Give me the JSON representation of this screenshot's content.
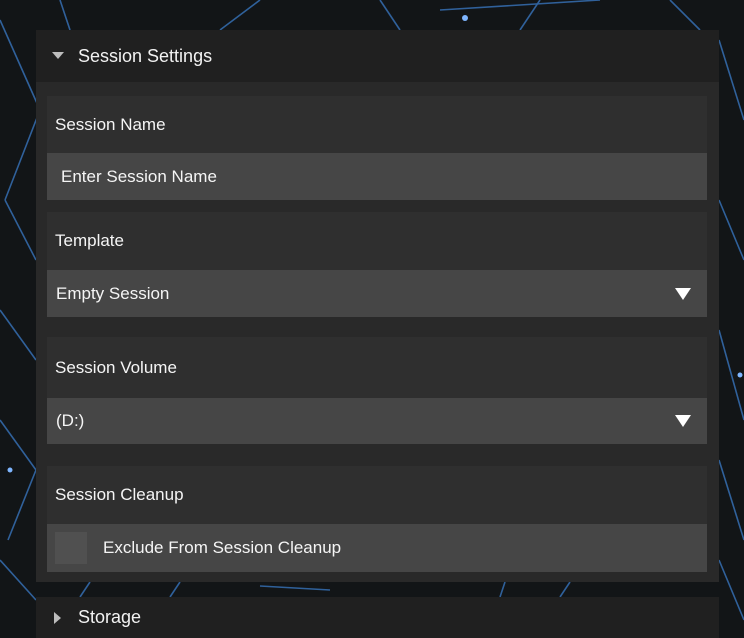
{
  "panel": {
    "session_settings": {
      "title": "Session Settings",
      "expanded": true
    },
    "storage": {
      "title": "Storage",
      "expanded": false
    }
  },
  "fields": {
    "session_name": {
      "label": "Session Name",
      "placeholder": "Enter Session Name",
      "value": ""
    },
    "template": {
      "label": "Template",
      "selected": "Empty Session"
    },
    "session_volume": {
      "label": "Session Volume",
      "selected": "(D:)"
    },
    "session_cleanup": {
      "label": "Session Cleanup",
      "checkbox_label": "Exclude From Session Cleanup",
      "checked": false
    }
  },
  "icons": {
    "expanded_caret": "caret-down-icon",
    "collapsed_caret": "caret-right-icon",
    "dropdown_arrow": "triangle-down-icon"
  },
  "colors": {
    "background": "#121517",
    "network_lines": "#3a7bc8",
    "header_bg": "#202020",
    "panel_bg": "#292929",
    "label_row_bg": "#2f2f2f",
    "field_bg": "#464646",
    "checkbox_bg": "#505050",
    "text": "#f5f5f5"
  }
}
